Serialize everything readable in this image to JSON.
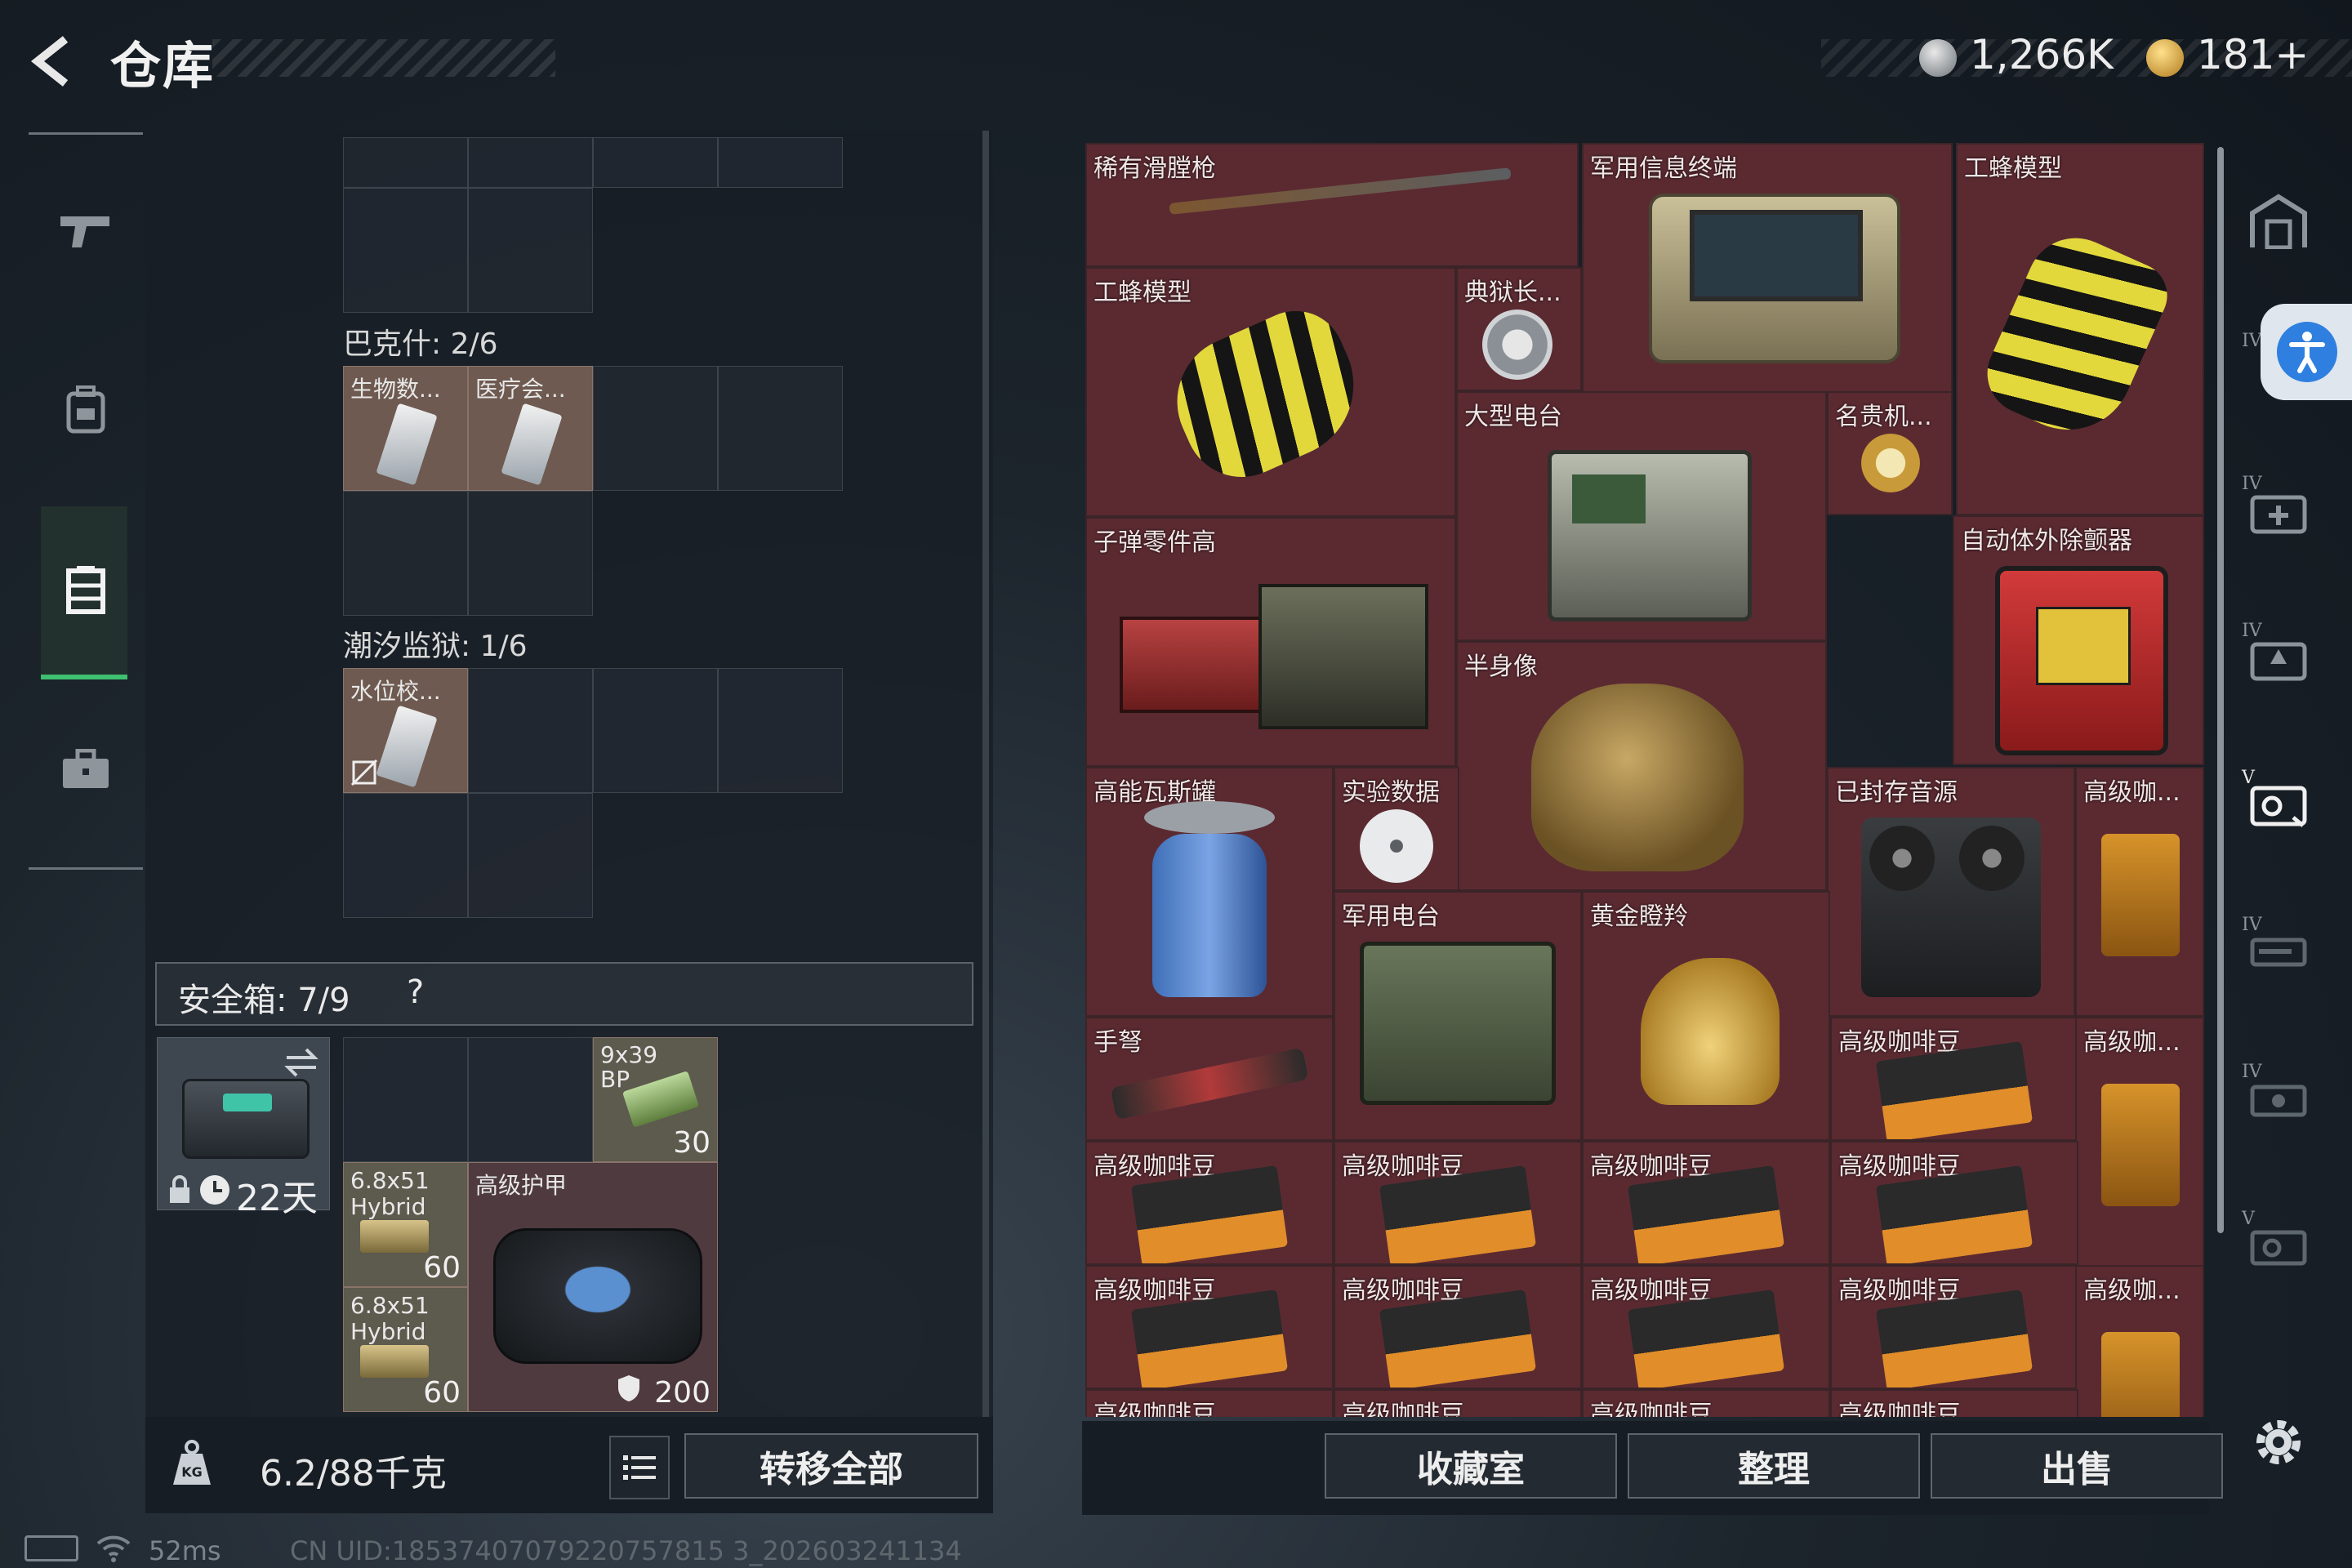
{
  "header": {
    "title": "仓库",
    "currency1": "1,266K",
    "currency2": "181+",
    "currency1_icon": "coin-icon",
    "currency2_icon": "bond-icon"
  },
  "left_nav": {
    "items": [
      "gun-icon",
      "backpack-icon",
      "storage-icon",
      "briefcase-icon"
    ],
    "active": "storage-icon"
  },
  "stash": {
    "sections": [
      {
        "name": "巴克什: 2/6",
        "items": [
          {
            "label": "生物数..."
          },
          {
            "label": "医疗会..."
          }
        ]
      },
      {
        "name": "潮汐监狱: 1/6",
        "items": [
          {
            "label": "水位校..."
          }
        ]
      }
    ],
    "safebox": {
      "label": "安全箱: 7/9",
      "help": "?",
      "timer": "22天"
    },
    "safebox_items": [
      {
        "label": "9x39 BP",
        "count": "30"
      },
      {
        "label": "6.8x51 Hybrid",
        "count": "60"
      },
      {
        "label": "6.8x51 Hybrid",
        "count": "60"
      },
      {
        "label": "高级护甲",
        "count": "200"
      }
    ],
    "weight": "6.2/88千克",
    "transfer_all": "转移全部"
  },
  "loot": {
    "items": [
      {
        "label": "稀有滑膛枪"
      },
      {
        "label": "军用信息终端"
      },
      {
        "label": "工蜂模型"
      },
      {
        "label": "工蜂模型"
      },
      {
        "label": "典狱长..."
      },
      {
        "label": "大型电台"
      },
      {
        "label": "名贵机..."
      },
      {
        "label": "子弹零件高"
      },
      {
        "label": "自动体外除颤器"
      },
      {
        "label": "半身像"
      },
      {
        "label": "高能瓦斯罐"
      },
      {
        "label": "实验数据"
      },
      {
        "label": "已封存音源"
      },
      {
        "label": "高级咖..."
      },
      {
        "label": "军用电台"
      },
      {
        "label": "黄金瞪羚"
      },
      {
        "label": "手弩"
      },
      {
        "label": "高级咖啡豆"
      },
      {
        "label": "高级咖..."
      },
      {
        "label": "高级咖啡豆"
      },
      {
        "label": "高级咖啡豆"
      },
      {
        "label": "高级咖啡豆"
      },
      {
        "label": "高级咖啡豆"
      },
      {
        "label": "高级咖啡豆"
      },
      {
        "label": "高级咖啡豆"
      },
      {
        "label": "高级咖啡豆"
      },
      {
        "label": "高级咖啡豆"
      },
      {
        "label": "高级咖..."
      },
      {
        "label": "高级咖啡豆"
      },
      {
        "label": "高级咖啡豆"
      },
      {
        "label": "高级咖啡豆"
      },
      {
        "label": "高级咖啡豆"
      }
    ],
    "buttons": {
      "collection": "收藏室",
      "sort": "整理",
      "sell": "出售"
    }
  },
  "right_nav": {
    "tiers": [
      "",
      "IV",
      "IV",
      "IV",
      "V",
      "IV",
      "IV",
      "V"
    ]
  },
  "status": {
    "ping": "52ms",
    "uid": "CN UID:18537407079220757815 3_202603241134"
  },
  "colors": {
    "accent_green": "#3fbf70",
    "loot_bg": "#5b2a31",
    "stash_item_bg": "#6e5a50"
  }
}
